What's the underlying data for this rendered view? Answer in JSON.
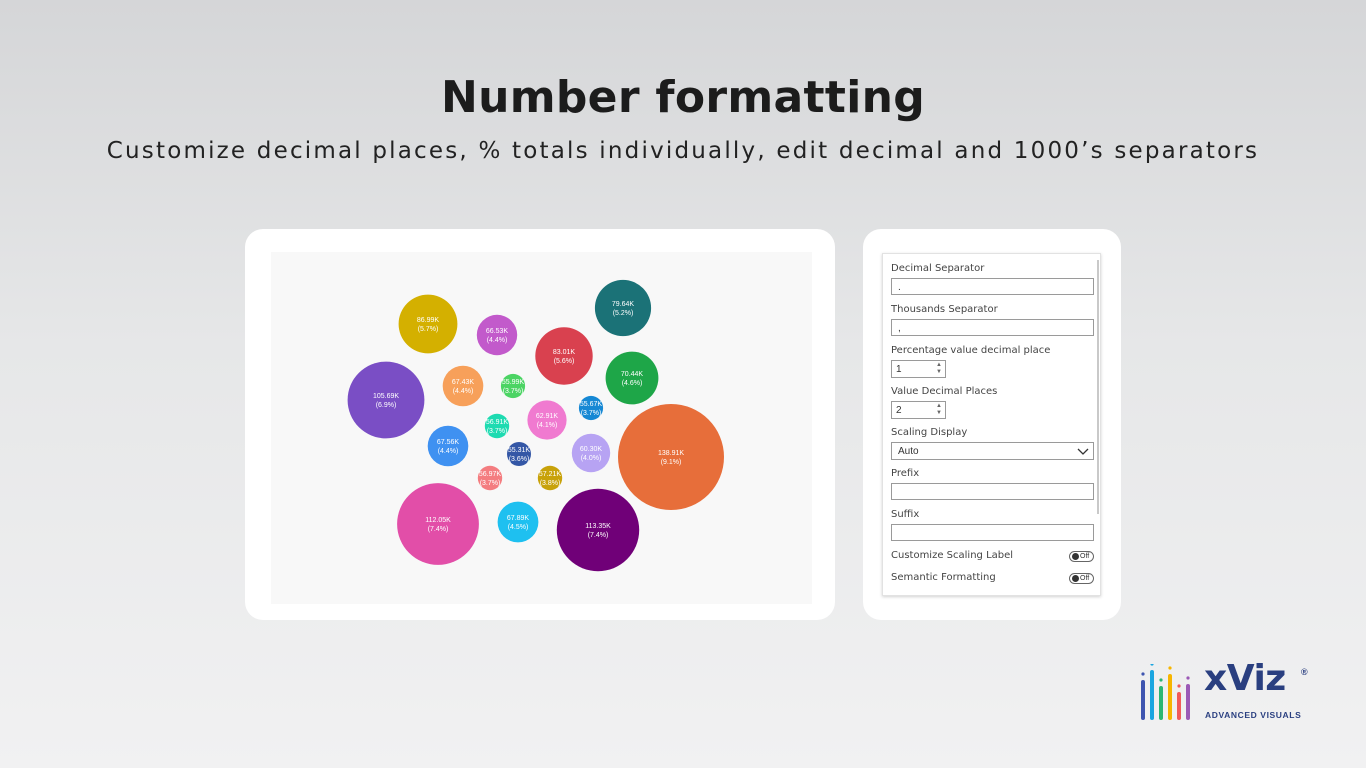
{
  "heading": {
    "title": "Number formatting",
    "subtitle": "Customize decimal places, % totals individually, edit decimal and 1000’s separators"
  },
  "chart_data": {
    "type": "bubble",
    "title": "",
    "bubbles": [
      {
        "value": "86.99K",
        "pct": "(5.7%)",
        "color": "#d4b000"
      },
      {
        "value": "66.53K",
        "pct": "(4.4%)",
        "color": "#c25acb"
      },
      {
        "value": "79.64K",
        "pct": "(5.2%)",
        "color": "#1b7277"
      },
      {
        "value": "83.01K",
        "pct": "(5.6%)",
        "color": "#d9414f"
      },
      {
        "value": "70.44K",
        "pct": "(4.6%)",
        "color": "#1ea648"
      },
      {
        "value": "105.69K",
        "pct": "(6.9%)",
        "color": "#7a4ec5"
      },
      {
        "value": "67.43K",
        "pct": "(4.4%)",
        "color": "#f7a05a"
      },
      {
        "value": "55.99K",
        "pct": "(3.7%)",
        "color": "#4cd464"
      },
      {
        "value": "55.67K",
        "pct": "(3.7%)",
        "color": "#1688d4"
      },
      {
        "value": "62.91K",
        "pct": "(4.1%)",
        "color": "#f07ad0"
      },
      {
        "value": "56.91K",
        "pct": "(3.7%)",
        "color": "#1edbb1"
      },
      {
        "value": "67.56K",
        "pct": "(4.4%)",
        "color": "#3f91f1"
      },
      {
        "value": "55.31K",
        "pct": "(3.6%)",
        "color": "#3457a6"
      },
      {
        "value": "60.30K",
        "pct": "(4.0%)",
        "color": "#b7a3f3"
      },
      {
        "value": "138.91K",
        "pct": "(9.1%)",
        "color": "#e76e3a"
      },
      {
        "value": "56.97K",
        "pct": "(3.7%)",
        "color": "#f47d80"
      },
      {
        "value": "57.21K",
        "pct": "(3.8%)",
        "color": "#c8a20a"
      },
      {
        "value": "112.05K",
        "pct": "(7.4%)",
        "color": "#e24ea8"
      },
      {
        "value": "67.89K",
        "pct": "(4.5%)",
        "color": "#1ec0f0"
      },
      {
        "value": "113.35K",
        "pct": "(7.4%)",
        "color": "#700078"
      }
    ]
  },
  "format_pane": {
    "decimal_separator": {
      "label": "Decimal Separator",
      "value": "."
    },
    "thousands_separator": {
      "label": "Thousands Separator",
      "value": ","
    },
    "percentage_decimal": {
      "label": "Percentage value decimal place",
      "value": "1"
    },
    "value_decimal": {
      "label": "Value Decimal Places",
      "value": "2"
    },
    "scaling_display": {
      "label": "Scaling Display",
      "value": "Auto"
    },
    "prefix": {
      "label": "Prefix",
      "value": ""
    },
    "suffix": {
      "label": "Suffix",
      "value": ""
    },
    "customize_scaling_label": {
      "label": "Customize Scaling Label",
      "state": "Off"
    },
    "semantic_formatting": {
      "label": "Semantic Formatting",
      "state": "Off"
    }
  },
  "logo": {
    "word": "xViz",
    "registered": "®",
    "tagline": "ADVANCED  VISUALS",
    "bar_colors": [
      "#3e55b0",
      "#1aa5e0",
      "#2bb673",
      "#f7b500",
      "#f15a5a",
      "#9b59b6"
    ]
  }
}
